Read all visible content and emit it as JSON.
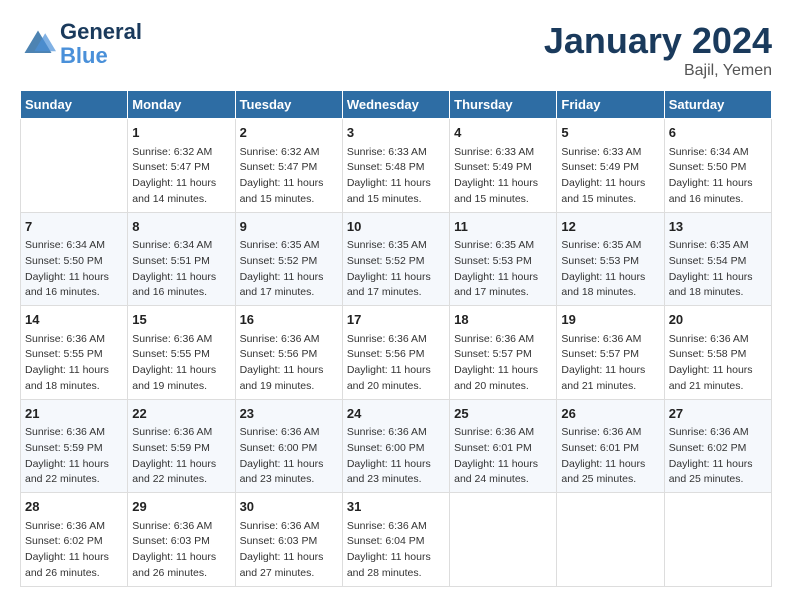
{
  "logo": {
    "line1": "General",
    "line2": "Blue"
  },
  "title": "January 2024",
  "location": "Bajil, Yemen",
  "days_of_week": [
    "Sunday",
    "Monday",
    "Tuesday",
    "Wednesday",
    "Thursday",
    "Friday",
    "Saturday"
  ],
  "weeks": [
    [
      {
        "day": "",
        "info": ""
      },
      {
        "day": "1",
        "info": "Sunrise: 6:32 AM\nSunset: 5:47 PM\nDaylight: 11 hours\nand 14 minutes."
      },
      {
        "day": "2",
        "info": "Sunrise: 6:32 AM\nSunset: 5:47 PM\nDaylight: 11 hours\nand 15 minutes."
      },
      {
        "day": "3",
        "info": "Sunrise: 6:33 AM\nSunset: 5:48 PM\nDaylight: 11 hours\nand 15 minutes."
      },
      {
        "day": "4",
        "info": "Sunrise: 6:33 AM\nSunset: 5:49 PM\nDaylight: 11 hours\nand 15 minutes."
      },
      {
        "day": "5",
        "info": "Sunrise: 6:33 AM\nSunset: 5:49 PM\nDaylight: 11 hours\nand 15 minutes."
      },
      {
        "day": "6",
        "info": "Sunrise: 6:34 AM\nSunset: 5:50 PM\nDaylight: 11 hours\nand 16 minutes."
      }
    ],
    [
      {
        "day": "7",
        "info": "Sunrise: 6:34 AM\nSunset: 5:50 PM\nDaylight: 11 hours\nand 16 minutes."
      },
      {
        "day": "8",
        "info": "Sunrise: 6:34 AM\nSunset: 5:51 PM\nDaylight: 11 hours\nand 16 minutes."
      },
      {
        "day": "9",
        "info": "Sunrise: 6:35 AM\nSunset: 5:52 PM\nDaylight: 11 hours\nand 17 minutes."
      },
      {
        "day": "10",
        "info": "Sunrise: 6:35 AM\nSunset: 5:52 PM\nDaylight: 11 hours\nand 17 minutes."
      },
      {
        "day": "11",
        "info": "Sunrise: 6:35 AM\nSunset: 5:53 PM\nDaylight: 11 hours\nand 17 minutes."
      },
      {
        "day": "12",
        "info": "Sunrise: 6:35 AM\nSunset: 5:53 PM\nDaylight: 11 hours\nand 18 minutes."
      },
      {
        "day": "13",
        "info": "Sunrise: 6:35 AM\nSunset: 5:54 PM\nDaylight: 11 hours\nand 18 minutes."
      }
    ],
    [
      {
        "day": "14",
        "info": "Sunrise: 6:36 AM\nSunset: 5:55 PM\nDaylight: 11 hours\nand 18 minutes."
      },
      {
        "day": "15",
        "info": "Sunrise: 6:36 AM\nSunset: 5:55 PM\nDaylight: 11 hours\nand 19 minutes."
      },
      {
        "day": "16",
        "info": "Sunrise: 6:36 AM\nSunset: 5:56 PM\nDaylight: 11 hours\nand 19 minutes."
      },
      {
        "day": "17",
        "info": "Sunrise: 6:36 AM\nSunset: 5:56 PM\nDaylight: 11 hours\nand 20 minutes."
      },
      {
        "day": "18",
        "info": "Sunrise: 6:36 AM\nSunset: 5:57 PM\nDaylight: 11 hours\nand 20 minutes."
      },
      {
        "day": "19",
        "info": "Sunrise: 6:36 AM\nSunset: 5:57 PM\nDaylight: 11 hours\nand 21 minutes."
      },
      {
        "day": "20",
        "info": "Sunrise: 6:36 AM\nSunset: 5:58 PM\nDaylight: 11 hours\nand 21 minutes."
      }
    ],
    [
      {
        "day": "21",
        "info": "Sunrise: 6:36 AM\nSunset: 5:59 PM\nDaylight: 11 hours\nand 22 minutes."
      },
      {
        "day": "22",
        "info": "Sunrise: 6:36 AM\nSunset: 5:59 PM\nDaylight: 11 hours\nand 22 minutes."
      },
      {
        "day": "23",
        "info": "Sunrise: 6:36 AM\nSunset: 6:00 PM\nDaylight: 11 hours\nand 23 minutes."
      },
      {
        "day": "24",
        "info": "Sunrise: 6:36 AM\nSunset: 6:00 PM\nDaylight: 11 hours\nand 23 minutes."
      },
      {
        "day": "25",
        "info": "Sunrise: 6:36 AM\nSunset: 6:01 PM\nDaylight: 11 hours\nand 24 minutes."
      },
      {
        "day": "26",
        "info": "Sunrise: 6:36 AM\nSunset: 6:01 PM\nDaylight: 11 hours\nand 25 minutes."
      },
      {
        "day": "27",
        "info": "Sunrise: 6:36 AM\nSunset: 6:02 PM\nDaylight: 11 hours\nand 25 minutes."
      }
    ],
    [
      {
        "day": "28",
        "info": "Sunrise: 6:36 AM\nSunset: 6:02 PM\nDaylight: 11 hours\nand 26 minutes."
      },
      {
        "day": "29",
        "info": "Sunrise: 6:36 AM\nSunset: 6:03 PM\nDaylight: 11 hours\nand 26 minutes."
      },
      {
        "day": "30",
        "info": "Sunrise: 6:36 AM\nSunset: 6:03 PM\nDaylight: 11 hours\nand 27 minutes."
      },
      {
        "day": "31",
        "info": "Sunrise: 6:36 AM\nSunset: 6:04 PM\nDaylight: 11 hours\nand 28 minutes."
      },
      {
        "day": "",
        "info": ""
      },
      {
        "day": "",
        "info": ""
      },
      {
        "day": "",
        "info": ""
      }
    ]
  ]
}
